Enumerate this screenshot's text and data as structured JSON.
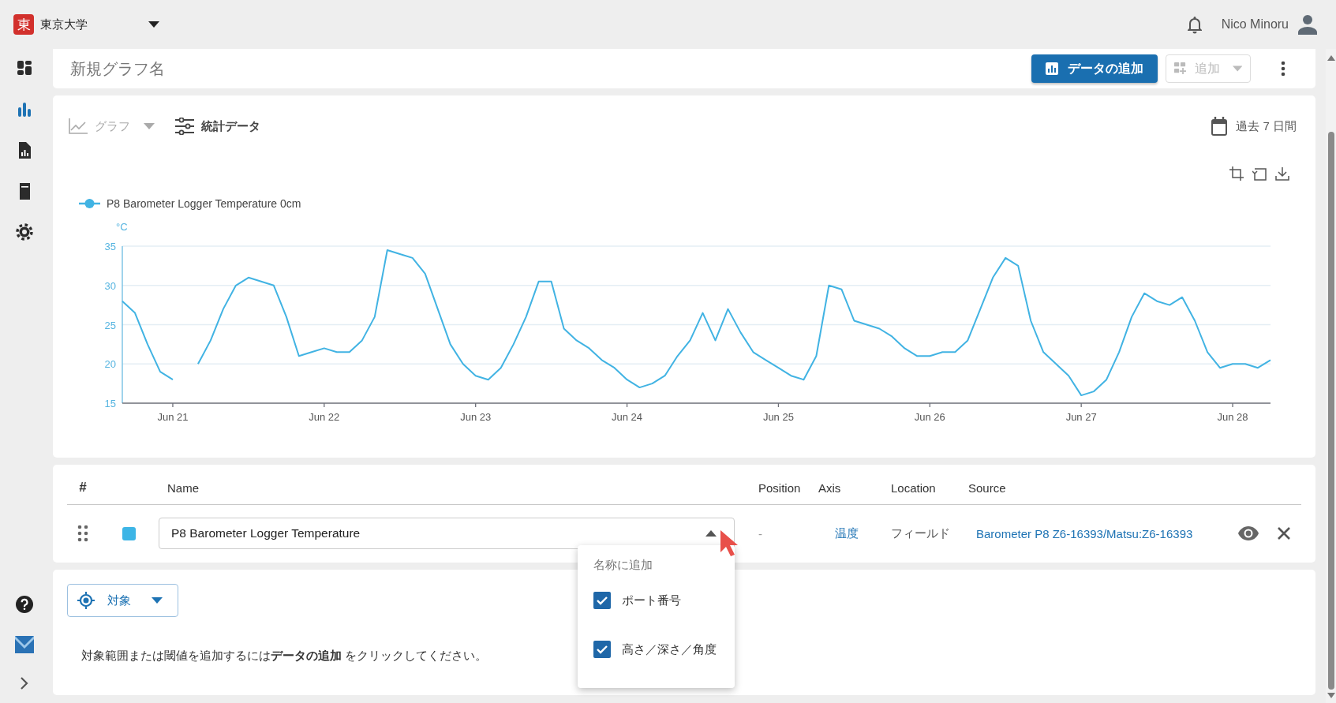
{
  "topbar": {
    "org_badge": "東",
    "org_name": "東京大学",
    "user_name": "Nico Minoru"
  },
  "sidebar": {
    "items": [
      {
        "selected": false
      },
      {
        "selected": true
      },
      {
        "selected": false
      },
      {
        "selected": false
      },
      {
        "selected": false
      }
    ]
  },
  "graph": {
    "title": "新規グラフ名",
    "add_data_button": {
      "label": "データの追加",
      "disabled": false
    },
    "add_button": {
      "label": "追加",
      "disabled": true
    }
  },
  "chart_panel": {
    "graph_type": {
      "label": "グラフ",
      "disabled": true
    },
    "stats_button": "統計データ",
    "date_range": "過去 7 日間",
    "chart_data": {
      "type": "line",
      "ylabel": "°C",
      "categories": [
        null,
        null,
        null,
        null,
        "Jun 21",
        null,
        null,
        null,
        null,
        null,
        null,
        null,
        null,
        null,
        null,
        null,
        "Jun 22",
        null,
        null,
        null,
        null,
        null,
        null,
        null,
        null,
        null,
        null,
        null,
        "Jun 23",
        null,
        null,
        null,
        null,
        null,
        null,
        null,
        null,
        null,
        null,
        null,
        "Jun 24",
        null,
        null,
        null,
        null,
        null,
        null,
        null,
        null,
        null,
        null,
        null,
        "Jun 25",
        null,
        null,
        null,
        null,
        null,
        null,
        null,
        null,
        null,
        null,
        null,
        "Jun 26",
        null,
        null,
        null,
        null,
        null,
        null,
        null,
        null,
        null,
        null,
        null,
        "Jun 27",
        null,
        null,
        null,
        null,
        null,
        null,
        null,
        null,
        null,
        null,
        null,
        "Jun 28",
        null,
        null,
        null
      ],
      "series": [
        {
          "name": "P8 Barometer Logger Temperature 0cm",
          "color": "#41b3e3",
          "values": [
            28,
            26.5,
            22.5,
            19,
            18,
            null,
            20,
            23,
            27,
            30,
            31,
            30.5,
            30,
            26,
            21,
            21.5,
            22,
            21.5,
            21.5,
            23,
            26,
            34.5,
            34,
            33.5,
            31.5,
            27,
            22.5,
            20,
            18.5,
            18,
            19.5,
            22.5,
            26,
            30.5,
            30.5,
            24.5,
            23,
            22,
            20.5,
            19.5,
            18,
            17,
            17.5,
            18.5,
            21,
            23,
            26.5,
            23,
            27,
            24,
            21.5,
            20.5,
            19.5,
            18.5,
            18,
            21,
            30,
            29.5,
            25.5,
            25,
            24.5,
            23.5,
            22,
            21,
            21,
            21.5,
            21.5,
            23,
            27,
            31,
            33.5,
            32.5,
            25.5,
            21.5,
            20,
            18.5,
            16,
            16.5,
            18,
            21.5,
            26,
            29,
            28,
            27.5,
            28.5,
            25.5,
            21.5,
            19.5,
            20,
            20,
            19.5,
            20.5
          ]
        }
      ],
      "ylim": [
        15,
        35
      ],
      "grid": true,
      "yticks": [
        15,
        20,
        25,
        30,
        35
      ]
    }
  },
  "series_table": {
    "columns": [
      "#",
      "Name",
      "Position",
      "Axis",
      "Location",
      "Source"
    ],
    "rows": [
      {
        "color": "#3db5e6",
        "name": "P8 Barometer Logger Temperature",
        "expanded": true,
        "position": "-",
        "axis": "温度",
        "location": "フィールド",
        "source": "Barometer P8 Z6-16393/Matsu:Z6-16393"
      }
    ]
  },
  "name_menu": {
    "title": "名称に追加",
    "options": [
      {
        "label": "ポート番号",
        "checked": true
      },
      {
        "label": "高さ／深さ／角度",
        "checked": true
      }
    ]
  },
  "targets": {
    "button": "対象",
    "hint": "対象範囲または閾値を追加するには**データの追加** をクリックしてください。"
  }
}
